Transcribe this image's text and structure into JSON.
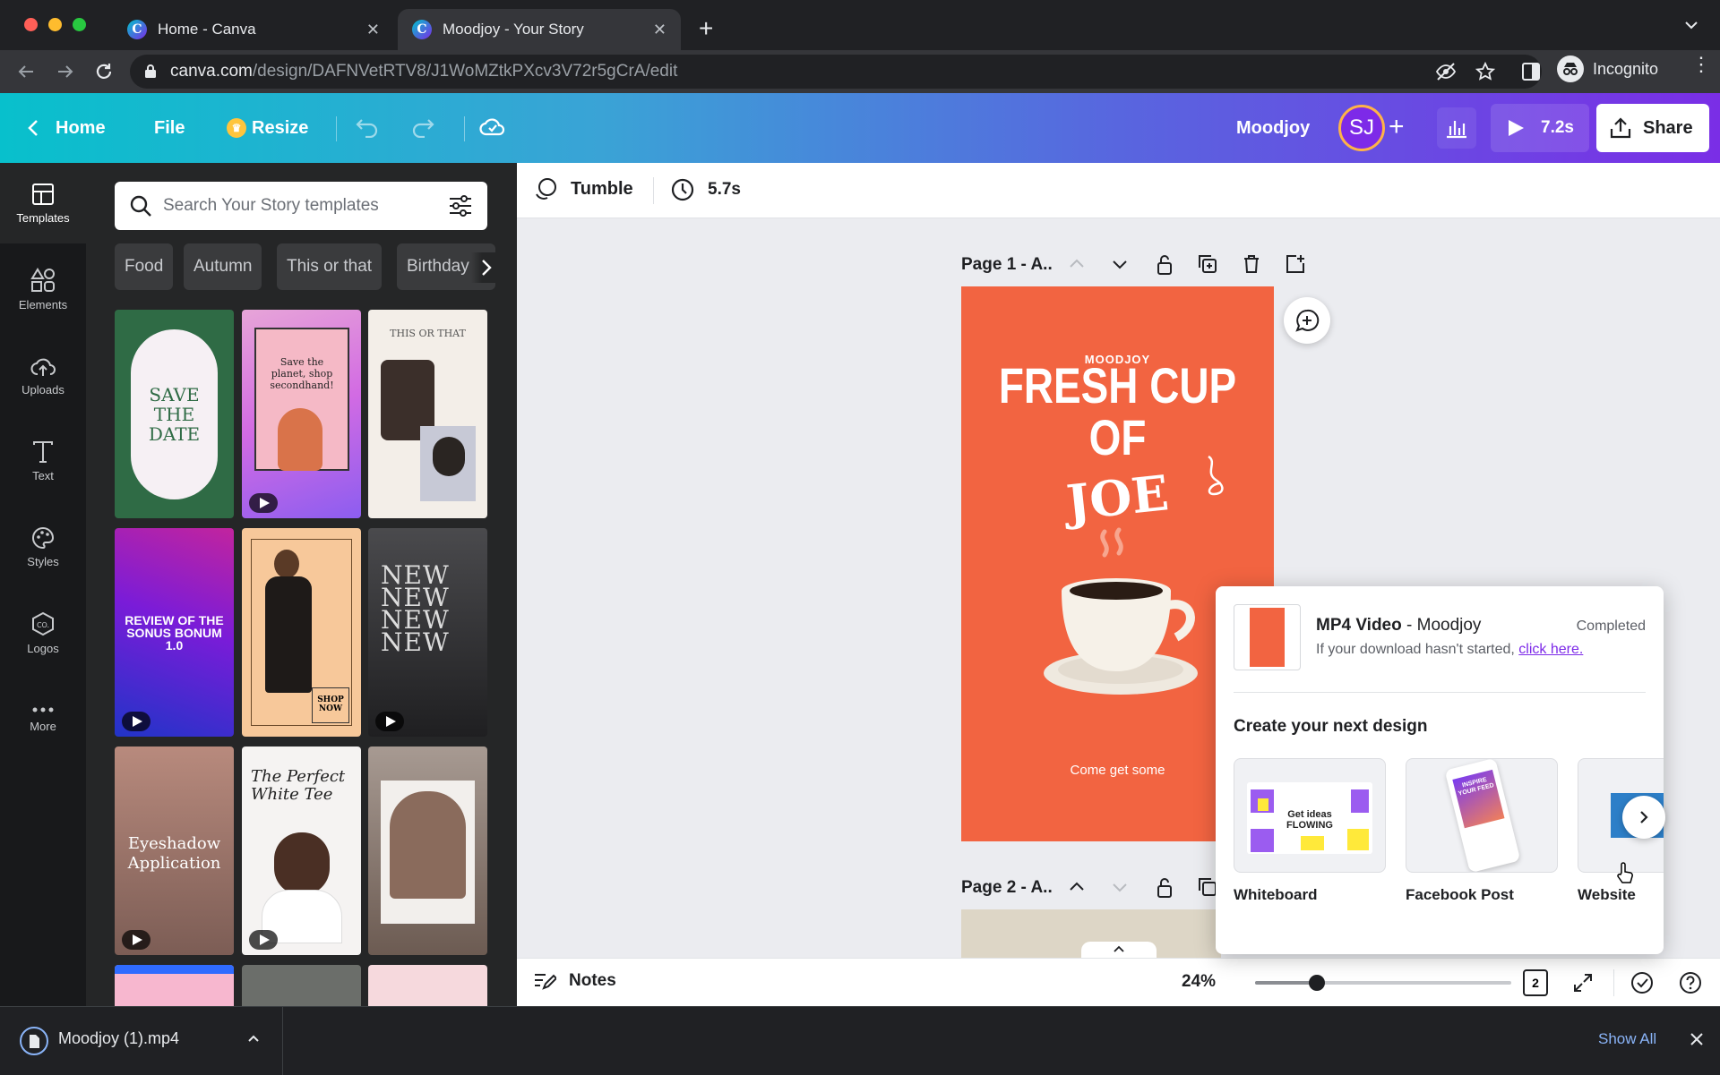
{
  "browser": {
    "tabs": [
      {
        "title": "Home - Canva"
      },
      {
        "title": "Moodjoy - Your Story"
      }
    ],
    "url_host": "canva.com",
    "url_path": "/design/DAFNVetRTV8/J1WoMZtkPXcv3V72r5gCrA/edit",
    "incognito_label": "Incognito"
  },
  "header": {
    "home": "Home",
    "file": "File",
    "resize": "Resize",
    "project_name": "Moodjoy",
    "avatar_initials": "SJ",
    "play_duration": "7.2s",
    "share": "Share"
  },
  "rail": {
    "items": [
      {
        "label": "Templates"
      },
      {
        "label": "Elements"
      },
      {
        "label": "Uploads"
      },
      {
        "label": "Text"
      },
      {
        "label": "Styles"
      },
      {
        "label": "Logos"
      },
      {
        "label": "More"
      }
    ]
  },
  "panel": {
    "search_placeholder": "Search Your Story templates",
    "chips": [
      "Food",
      "Autumn",
      "This or that",
      "Birthday"
    ],
    "templates": [
      {
        "text": "SAVE THE DATE"
      },
      {
        "text": "Save the planet, shop secondhand!"
      },
      {
        "text": "THIS OR THAT"
      },
      {
        "text": "REVIEW OF THE SONUS BONUM 1.0"
      },
      {
        "text": "SHOP NOW"
      },
      {
        "text": "NEW NEW NEW NEW"
      },
      {
        "text": "Eyeshadow Application"
      },
      {
        "text": "The Perfect White Tee"
      },
      {
        "text": ""
      }
    ]
  },
  "toolbar": {
    "animation": "Tumble",
    "duration": "5.7s"
  },
  "canvas": {
    "page1_label": "Page 1 - A..",
    "page2_label": "Page 2 - A..",
    "design": {
      "brand": "MOODJOY",
      "headline_line1": "FRESH CUP",
      "headline_line2": "OF",
      "headline_line3": "JOE",
      "tagline": "Come get some",
      "bg_color": "#f26441"
    }
  },
  "footer": {
    "notes": "Notes",
    "zoom": "24%",
    "zoom_level": 0.24,
    "page_count": "2"
  },
  "popup": {
    "title_bold": "MP4 Video",
    "title_rest": " - Moodjoy",
    "status": "Completed",
    "message": "If your download hasn't started, ",
    "link": "click here.",
    "section": "Create your next design",
    "cards": [
      {
        "label": "Whiteboard",
        "thumb_text": "Get ideas FLOWING"
      },
      {
        "label": "Facebook Post",
        "thumb_text": "INSPIRE YOUR FEED"
      },
      {
        "label": "Website"
      }
    ]
  },
  "downloads": {
    "file": "Moodjoy (1).mp4",
    "show_all": "Show All"
  },
  "colors": {
    "accent_purple": "#7d2ae8",
    "teal": "#00c4cc",
    "design_orange": "#f26441"
  }
}
